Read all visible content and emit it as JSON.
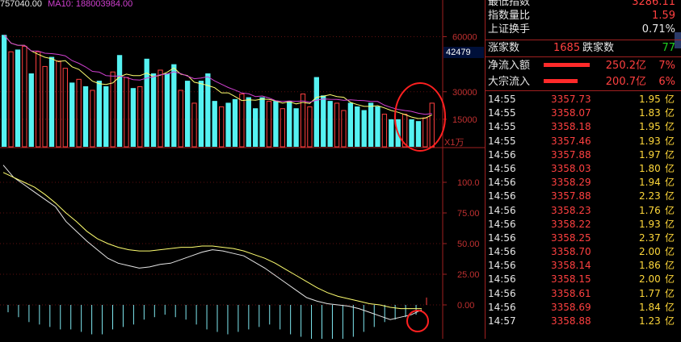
{
  "legend": {
    "volume": "757040.00",
    "ma10": "MA10: 188003984.00"
  },
  "volume_axis": {
    "ticks": [
      "60000",
      "30000",
      "15000"
    ],
    "price_tag": "42479",
    "unit": "X1万"
  },
  "osc_axis": {
    "ticks": [
      "100.0",
      "75.00",
      "50.00",
      "25.00",
      "0.00"
    ]
  },
  "panel": {
    "rows": [
      {
        "label": "最低指数",
        "value": "3286.11",
        "color": "red"
      },
      {
        "label": "指数量比",
        "value": "1.59",
        "color": "red"
      },
      {
        "label": "上证换手",
        "value": "0.71%",
        "color": "white"
      }
    ],
    "breadth": {
      "up_label": "涨家数",
      "up_value": "1685",
      "down_label": "跌家数",
      "down_value": "77"
    },
    "flows": [
      {
        "label": "净流入额",
        "amount": "250.2亿",
        "pct": "7%",
        "bar": 0.95
      },
      {
        "label": "大宗流入",
        "amount": "200.7亿",
        "pct": "6%",
        "bar": 0.7
      }
    ],
    "ticks": [
      {
        "time": "14:55",
        "price": "3357.73",
        "amount": "1.95",
        "unit": "亿"
      },
      {
        "time": "14:55",
        "price": "3358.07",
        "amount": "1.83",
        "unit": "亿"
      },
      {
        "time": "14:55",
        "price": "3358.18",
        "amount": "1.95",
        "unit": "亿"
      },
      {
        "time": "14:55",
        "price": "3357.46",
        "amount": "1.93",
        "unit": "亿"
      },
      {
        "time": "14:56",
        "price": "3357.88",
        "amount": "1.97",
        "unit": "亿"
      },
      {
        "time": "14:56",
        "price": "3358.03",
        "amount": "1.80",
        "unit": "亿"
      },
      {
        "time": "14:56",
        "price": "3358.29",
        "amount": "1.94",
        "unit": "亿"
      },
      {
        "time": "14:56",
        "price": "3357.88",
        "amount": "2.23",
        "unit": "亿"
      },
      {
        "time": "14:56",
        "price": "3358.23",
        "amount": "1.76",
        "unit": "亿"
      },
      {
        "time": "14:56",
        "price": "3358.22",
        "amount": "1.93",
        "unit": "亿"
      },
      {
        "time": "14:56",
        "price": "3358.25",
        "amount": "2.37",
        "unit": "亿"
      },
      {
        "time": "14:56",
        "price": "3358.70",
        "amount": "2.00",
        "unit": "亿"
      },
      {
        "time": "14:56",
        "price": "3358.14",
        "amount": "1.86",
        "unit": "亿"
      },
      {
        "time": "14:56",
        "price": "3358.15",
        "amount": "2.00",
        "unit": "亿"
      },
      {
        "time": "14:56",
        "price": "3358.61",
        "amount": "1.77",
        "unit": "亿"
      },
      {
        "time": "14:56",
        "price": "3358.69",
        "amount": "1.84",
        "unit": "亿"
      },
      {
        "time": "14:57",
        "price": "3358.88",
        "amount": "1.23",
        "unit": "亿"
      }
    ]
  },
  "colors": {
    "cyan": "#55f2f2",
    "red": "#ff4040",
    "ma_yellow": "#ffff70",
    "ma_magenta": "#d040d0",
    "axis": "#a02020"
  },
  "chart_data": [
    {
      "type": "bar",
      "ylim": [
        0,
        80000
      ],
      "ticks": [
        15000,
        30000,
        60000
      ],
      "values": [
        61000,
        52000,
        53000,
        55000,
        40000,
        52000,
        44000,
        49000,
        47000,
        43000,
        35000,
        37000,
        33000,
        31000,
        36000,
        33000,
        41000,
        50000,
        38000,
        32000,
        33000,
        48000,
        40000,
        42000,
        40000,
        45000,
        31000,
        36000,
        24000,
        36000,
        40000,
        25000,
        22000,
        24000,
        26000,
        29000,
        27000,
        21000,
        27000,
        25000,
        25000,
        21000,
        25000,
        21000,
        29000,
        22000,
        38000,
        28000,
        25000,
        24000,
        20000,
        24000,
        22000,
        20000,
        24000,
        22000,
        18000,
        15000,
        15000,
        18000,
        15000,
        14000,
        16000,
        24000
      ],
      "up": [
        false,
        true,
        false,
        true,
        false,
        true,
        true,
        false,
        true,
        true,
        false,
        true,
        false,
        true,
        false,
        false,
        true,
        false,
        true,
        false,
        true,
        false,
        false,
        true,
        false,
        false,
        true,
        false,
        true,
        false,
        false,
        false,
        true,
        false,
        false,
        true,
        false,
        false,
        false,
        true,
        false,
        true,
        false,
        false,
        true,
        true,
        false,
        false,
        false,
        true,
        true,
        false,
        false,
        false,
        false,
        false,
        true,
        false,
        false,
        true,
        false,
        false,
        true,
        true
      ]
    },
    {
      "type": "line",
      "ylim": [
        0,
        125
      ],
      "ticks": [
        0,
        25,
        50,
        75,
        100
      ],
      "series": [
        {
          "values": [
            114,
            104,
            98,
            92,
            86,
            80,
            68,
            60,
            52,
            45,
            38,
            34,
            32,
            30,
            31,
            33,
            34,
            37,
            40,
            43,
            45,
            44,
            42,
            40,
            35,
            30,
            24,
            18,
            12,
            6,
            3,
            1,
            0,
            -1,
            -3,
            -6,
            -9,
            -12,
            -10,
            -8,
            -4
          ]
        },
        {
          "values": [
            108,
            104,
            100,
            96,
            90,
            83,
            75,
            68,
            60,
            54,
            50,
            47,
            45,
            44,
            44,
            45,
            46,
            47,
            47,
            48,
            48,
            47,
            46,
            44,
            41,
            38,
            34,
            29,
            24,
            19,
            14,
            10,
            7,
            5,
            3,
            1,
            0,
            -2,
            -3,
            -3,
            -3
          ]
        }
      ],
      "histogram": [
        -6,
        -10,
        -14,
        -16,
        -18,
        -20,
        -20,
        -22,
        -24,
        -24,
        -20,
        -18,
        -16,
        -12,
        -10,
        -8,
        -10,
        -12,
        -16,
        -20,
        -22,
        -24,
        -22,
        -20,
        -18,
        -16,
        -20,
        -24,
        -26,
        -30,
        -32,
        -30,
        -28,
        -26,
        -22,
        -18,
        -14,
        -12,
        -10,
        -8,
        6
      ]
    }
  ]
}
